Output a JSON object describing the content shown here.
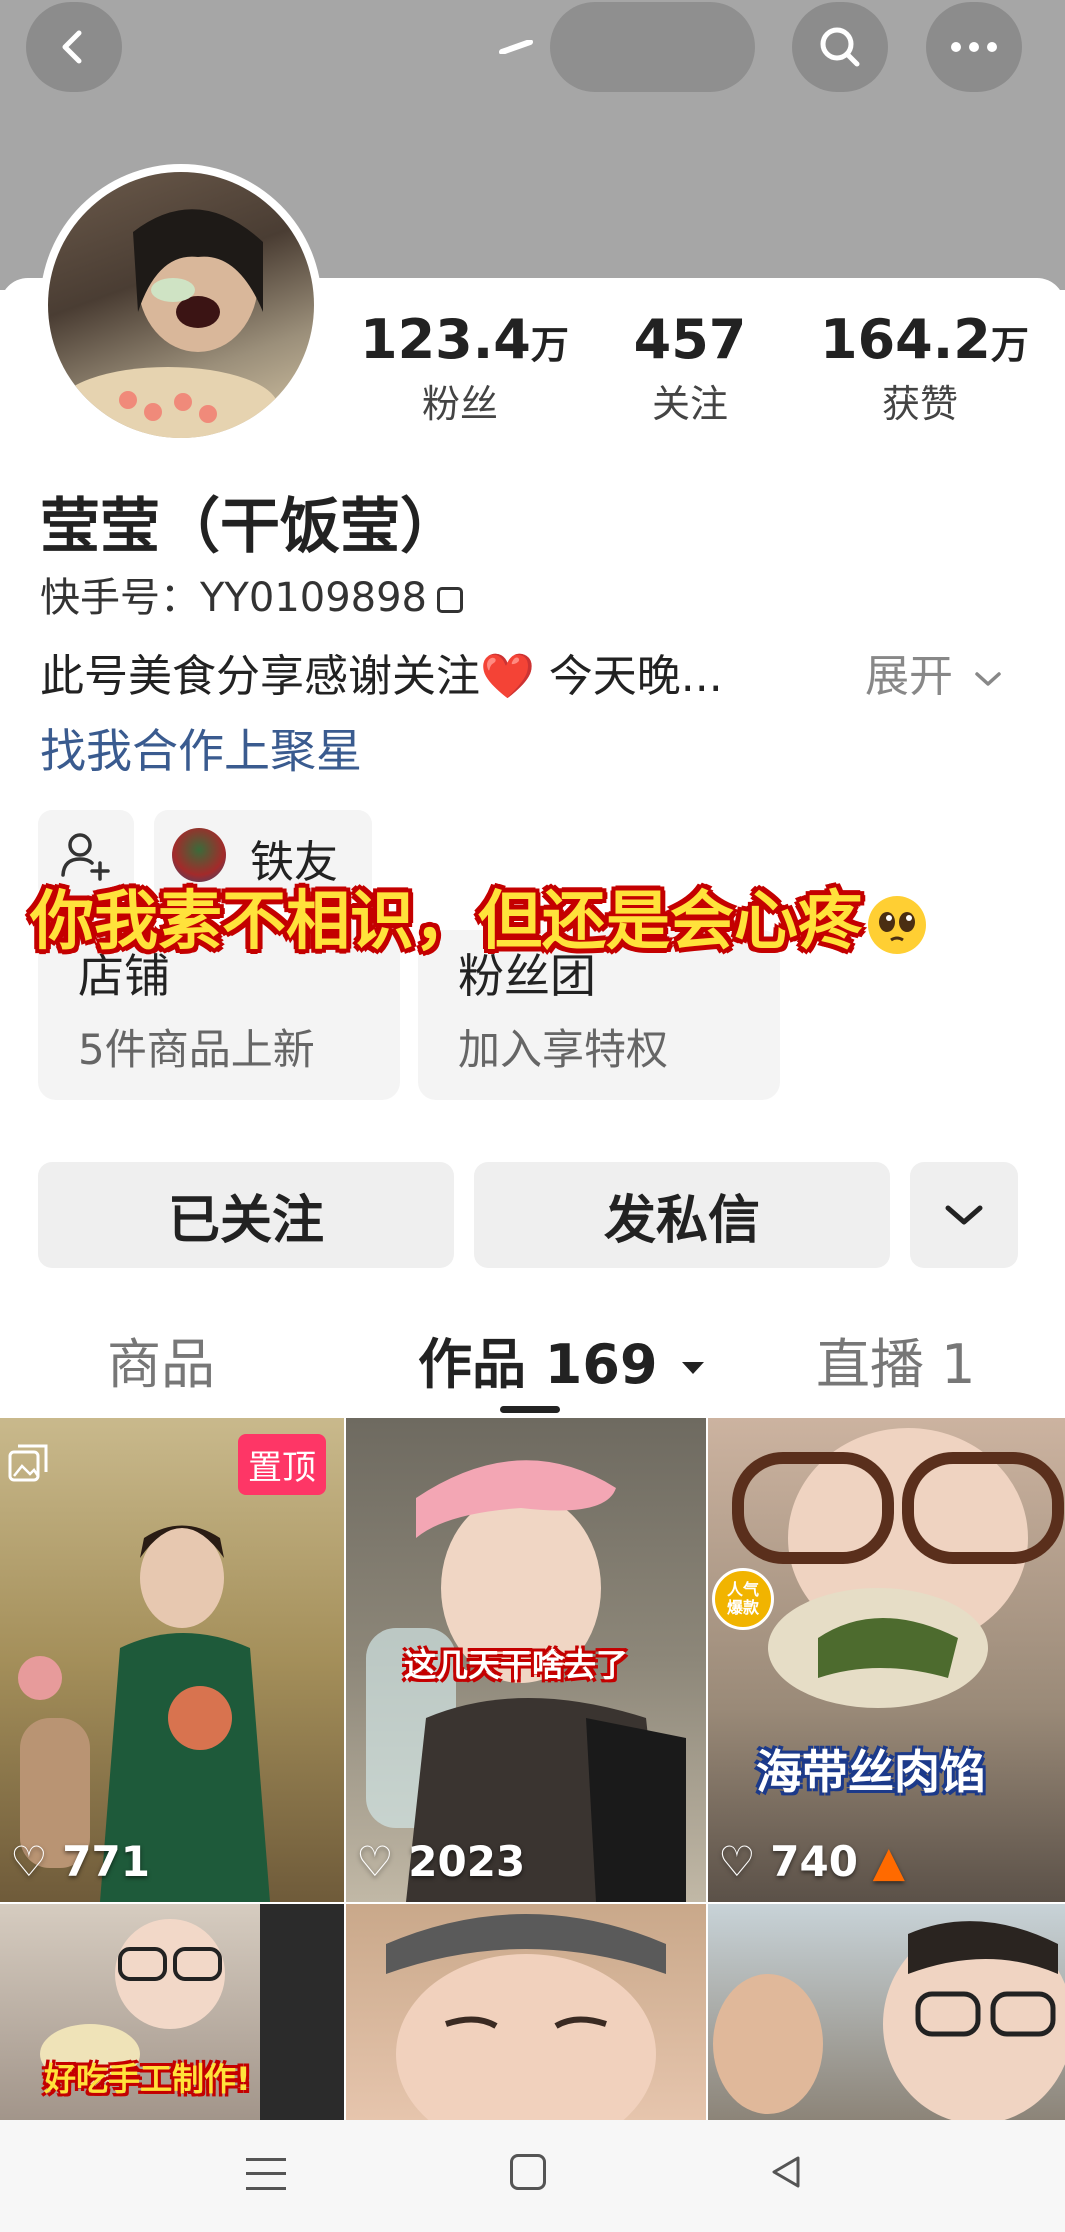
{
  "header": {
    "back_icon": "chevron-left-icon",
    "search_icon": "search-icon",
    "more_icon": "more-horizontal-icon"
  },
  "profile": {
    "name": "莹莹（干饭莹）",
    "kuaishou_id": "快手号：YY0109898",
    "bio": "此号美食分享感谢关注❤️ 今天晚...",
    "expand_label": "展开",
    "cooperation_link": "找我合作上聚星",
    "stats": [
      {
        "value": "123.4",
        "unit": "万",
        "label": "粉丝"
      },
      {
        "value": "457",
        "unit": "",
        "label": "关注"
      },
      {
        "value": "164.2",
        "unit": "万",
        "label": "获赞"
      }
    ]
  },
  "chips": {
    "friend_label": "铁友"
  },
  "overlay_text": "你我素不相识，但还是会心疼",
  "tiles": [
    {
      "title": "店铺",
      "subtitle": "5件商品上新"
    },
    {
      "title": "粉丝团",
      "subtitle": "加入享特权"
    }
  ],
  "actions": {
    "follow_label": "已关注",
    "message_label": "发私信"
  },
  "tabs": {
    "goods": "商品",
    "works": "作品 169",
    "live": "直播 1"
  },
  "grid": [
    {
      "likes": "771",
      "pinned_label": "置顶",
      "caption": ""
    },
    {
      "likes": "2023",
      "caption": "这几天干啥去了"
    },
    {
      "likes": "740",
      "caption": "海带丝肉馅",
      "badge": "人气爆款"
    },
    {
      "likes": "",
      "caption": "好吃手工制作!"
    },
    {
      "likes": "",
      "caption": ""
    },
    {
      "likes": "",
      "caption": ""
    }
  ],
  "colors": {
    "header_bg": "#a6a6a6",
    "link": "#3a5b8f",
    "pin": "#fe3666",
    "overlay_text": "#ffe23b",
    "overlay_stroke": "#c40000"
  }
}
